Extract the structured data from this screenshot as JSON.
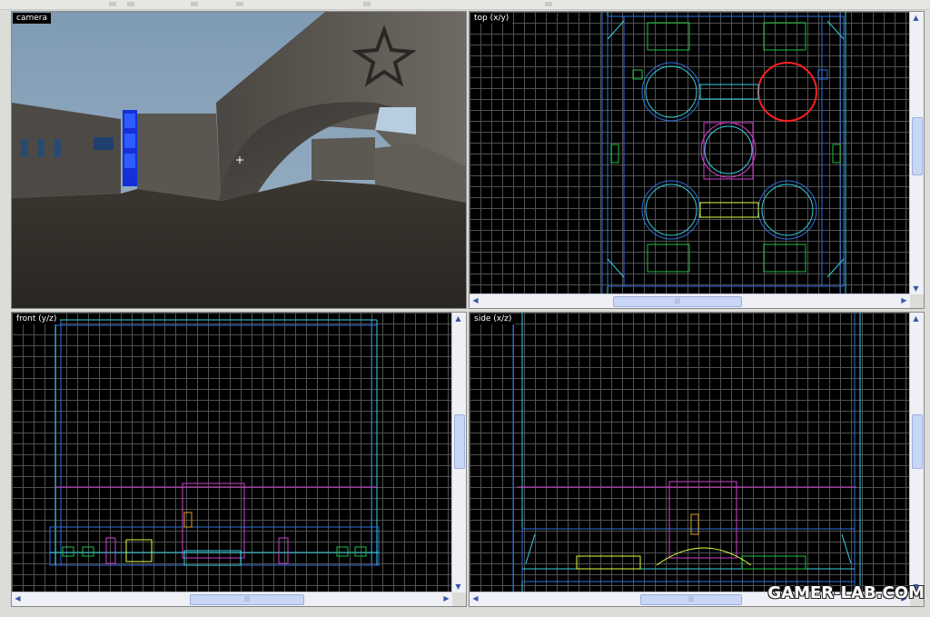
{
  "viewports": {
    "camera": {
      "label": "camera"
    },
    "top": {
      "label": "top (x/y)"
    },
    "front": {
      "label": "front (y/z)"
    },
    "side": {
      "label": "side (x/z)"
    }
  },
  "scroll": {
    "thumb_glyph": "|||",
    "left_arrow": "◀",
    "right_arrow": "▶",
    "up_arrow": "▲",
    "down_arrow": "▼"
  },
  "watermark": {
    "text": "GAMER-LAB.COM"
  },
  "colors": {
    "grid": "#505050",
    "brush_blue": "#2f6fdc",
    "brush_cyan": "#35d0e0",
    "entity_magenta": "#d040d0",
    "entity_green": "#20c040",
    "selected_red": "#ff2020",
    "highlight_yellow": "#e0ff40"
  }
}
